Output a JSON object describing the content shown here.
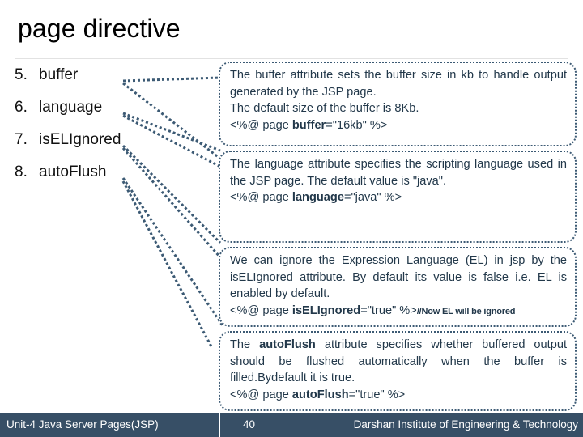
{
  "slide": {
    "title": "page directive",
    "accent_color": "#3c5a74",
    "callout_text_color": "#22384a",
    "footer_bg_color": "#374f66",
    "title_color": "#000000"
  },
  "attributes": [
    {
      "number": "5.",
      "label": "buffer"
    },
    {
      "number": "6.",
      "label": "language"
    },
    {
      "number": "7.",
      "label": "isELIgnored"
    },
    {
      "number": "8.",
      "label": "autoFlush"
    }
  ],
  "callouts": {
    "buffer": {
      "line1": "The buffer attribute sets the buffer size in kb to handle output generated by the JSP page.",
      "line2": "The default size of the buffer is 8Kb.",
      "code_prefix": "<%@ page ",
      "code_attr": "buffer",
      "code_suffix": "=\"16kb\" %>"
    },
    "language": {
      "line1": "The language attribute specifies the scripting language used in the JSP page. The default value is \"java\".",
      "code_prefix": "<%@ page ",
      "code_attr": "language",
      "code_suffix": "=\"java\" %>"
    },
    "iselignored": {
      "line1": "We can ignore the Expression Language (EL) in jsp by the isELIgnored attribute. By default its value is false i.e. EL is enabled by default.",
      "code_prefix": "<%@ page ",
      "code_attr": "isELIgnored",
      "code_suffix": "=\"true\" %>",
      "code_note": "//Now EL will be ignored"
    },
    "autoflush": {
      "line1_prefix": "The ",
      "line1_attr": "autoFlush",
      "line1_rest": " attribute specifies whether buffered output should be flushed automatically when the buffer is filled.Bydefault it is true.",
      "code_prefix": "<%@ page ",
      "code_attr": "autoFlush",
      "code_suffix": "=\"true\" %>"
    }
  },
  "footer": {
    "left": "Unit-4 Java Server Pages(JSP)",
    "page_number": "40",
    "right": "Darshan Institute of Engineering & Technology"
  }
}
